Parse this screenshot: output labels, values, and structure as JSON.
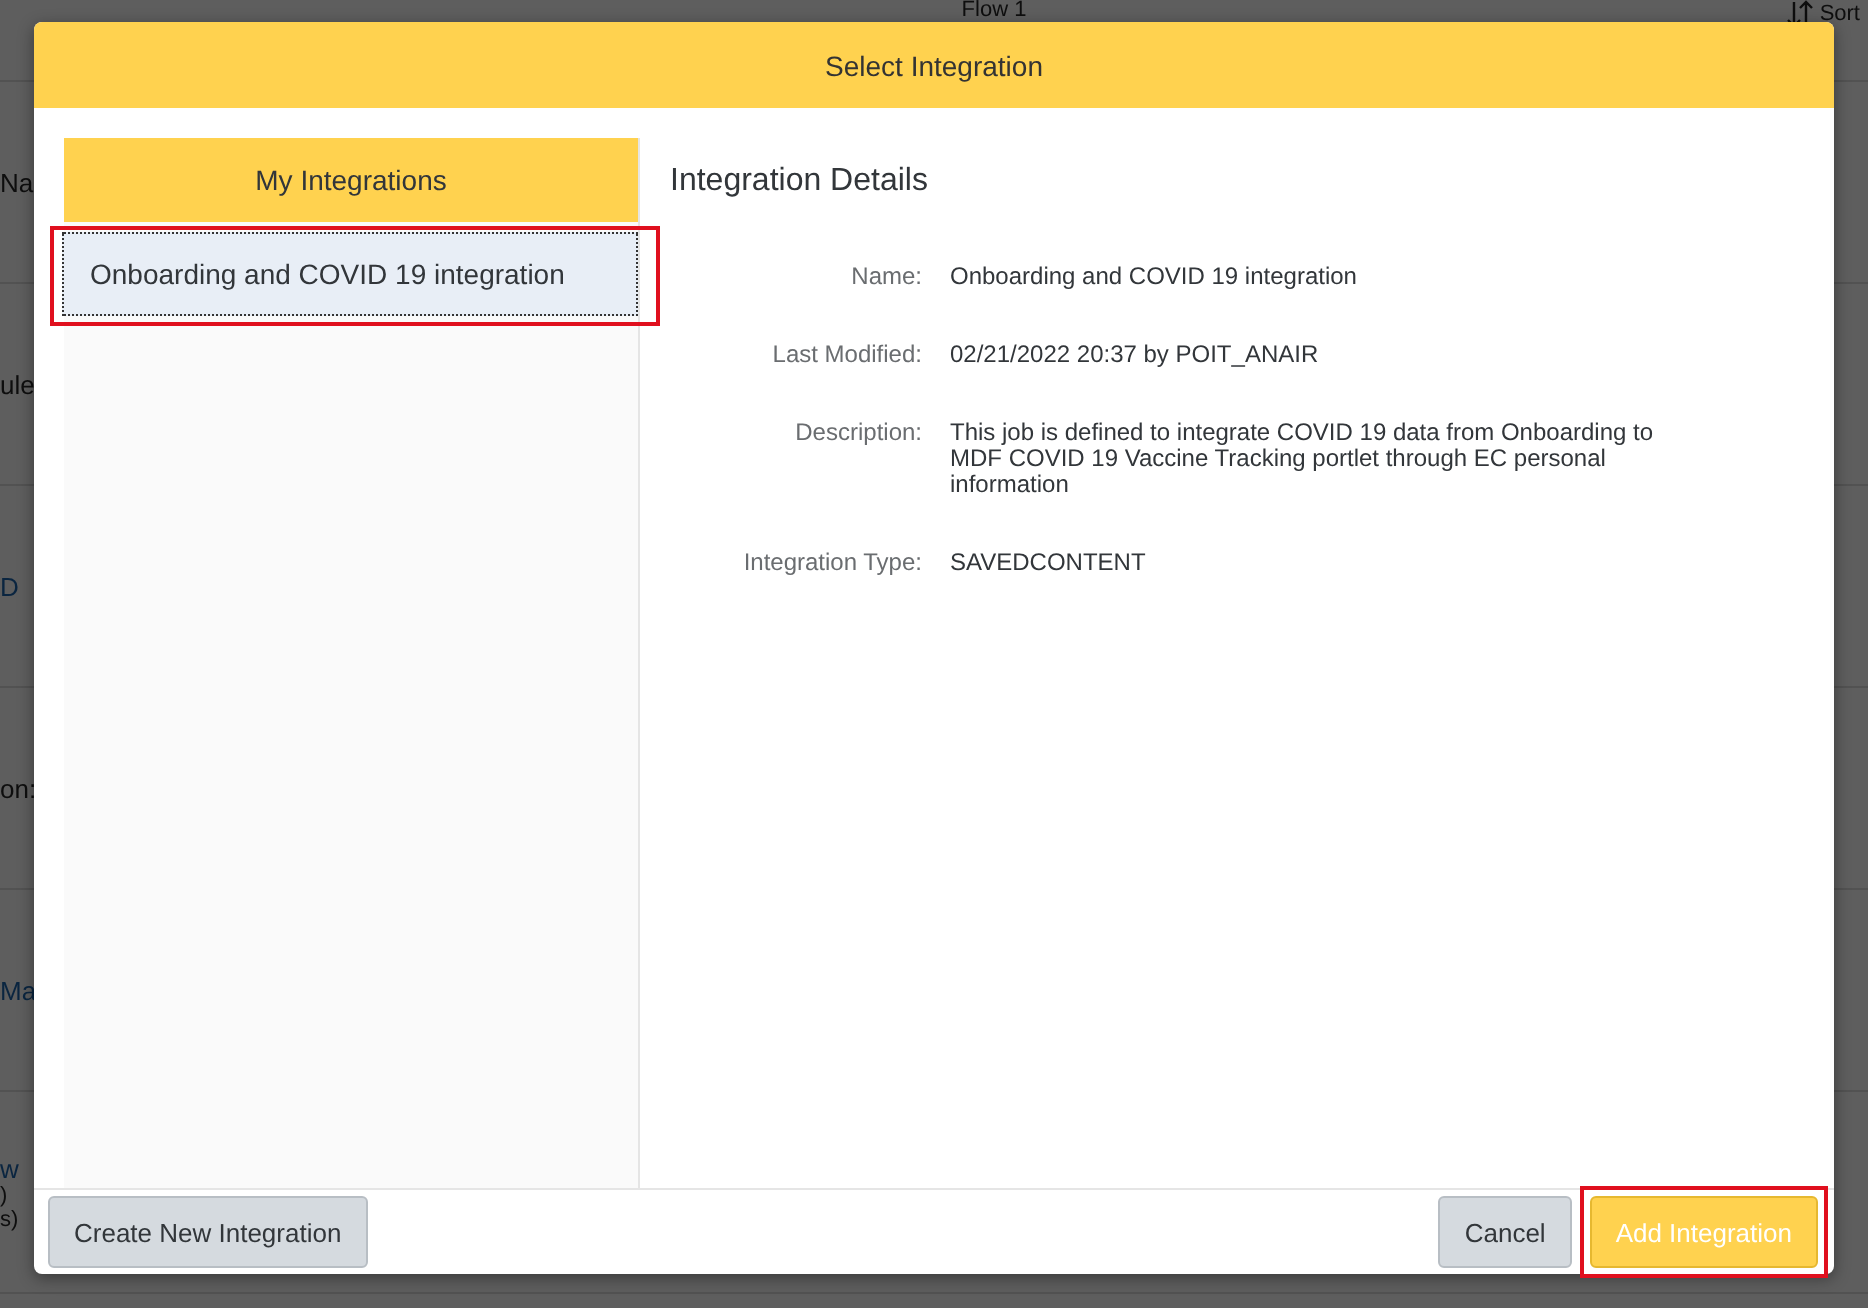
{
  "background": {
    "title": "Flow 1",
    "sort_label": "Sort",
    "row_fragments": [
      {
        "text": "Na",
        "kind": "label"
      },
      {
        "text": "ule",
        "kind": "label"
      },
      {
        "text": "D",
        "kind": "link"
      },
      {
        "text": "on:",
        "kind": "label"
      },
      {
        "text": "Ma",
        "kind": "link"
      },
      {
        "text": "w",
        "kind": "link",
        "sublines": [
          ")",
          "s)"
        ]
      }
    ]
  },
  "dialog": {
    "title": "Select Integration",
    "list": {
      "title": "My Integrations",
      "items": [
        {
          "label": "Onboarding and COVID 19 integration",
          "selected": true,
          "highlighted": true
        }
      ]
    },
    "details": {
      "title": "Integration Details",
      "fields": [
        {
          "label": "Name:",
          "value": "Onboarding and COVID 19 integration"
        },
        {
          "label": "Last Modified:",
          "value": "02/21/2022 20:37 by POIT_ANAIR"
        },
        {
          "label": "Description:",
          "value": "This job is defined to integrate COVID 19 data from Onboarding to MDF COVID 19 Vaccine Tracking portlet through EC personal information"
        },
        {
          "label": "Integration Type:",
          "value": "SAVEDCONTENT"
        }
      ]
    },
    "footer": {
      "left_buttons": [
        {
          "label": "Create New Integration",
          "kind": "secondary",
          "highlighted": false
        }
      ],
      "right_buttons": [
        {
          "label": "Cancel",
          "kind": "secondary",
          "highlighted": false
        },
        {
          "label": "Add Integration",
          "kind": "primary",
          "highlighted": true
        }
      ]
    }
  }
}
